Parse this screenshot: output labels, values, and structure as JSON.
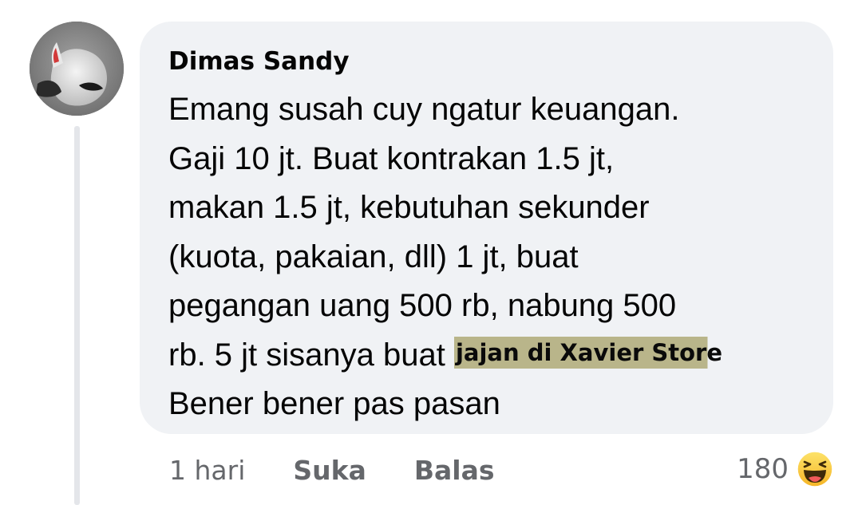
{
  "comment": {
    "author": "Dimas Sandy",
    "lines": [
      "Emang susah cuy ngatur keuangan.",
      "Gaji 10 jt. Buat kontrakan 1.5 jt,",
      "makan 1.5 jt, kebutuhan sekunder",
      "(kuota, pakaian, dll) 1 jt, buat",
      "pegangan uang 500 rb, nabung 500",
      "rb. 5 jt sisanya buat",
      "Bener bener pas pasan"
    ],
    "highlight_text": "jajan di Xavier Store",
    "highlight_color": "#b9b58a",
    "bubble_color": "#f0f2f5"
  },
  "actions": {
    "time": "1 hari",
    "like_label": "Suka",
    "reply_label": "Balas"
  },
  "reactions": {
    "count": "180",
    "icon": "haha-emoji-icon"
  },
  "avatar": {
    "icon": "profile-avatar"
  }
}
